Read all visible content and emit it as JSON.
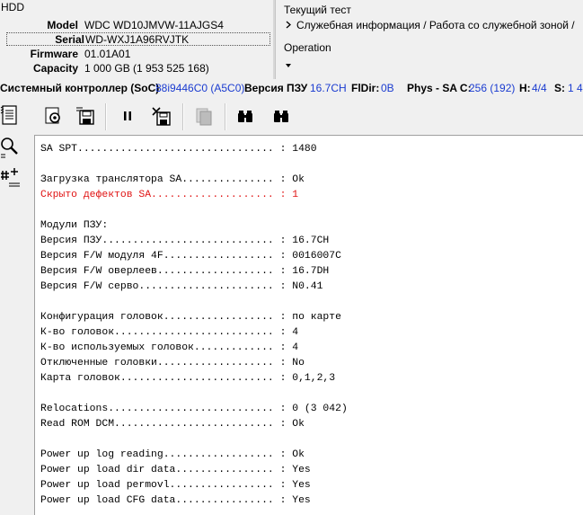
{
  "hdd": {
    "title": "HDD",
    "model_label": "Model",
    "model_value": "WDC WD10JMVW-11AJGS4",
    "serial_label": "Serial",
    "serial_value": "WD-WXJ1A96RVJTK",
    "firmware_label": "Firmware",
    "firmware_value": "01.01A01",
    "capacity_label": "Capacity",
    "capacity_value": "1 000 GB (1 953 525 168)"
  },
  "test": {
    "title": "Текущий тест",
    "current": "Служебная информация / Работа со служебной зоной /",
    "operation_title": "Operation",
    "operation_value": ""
  },
  "status": {
    "soc_label": "Системный контроллер (SoC)",
    "soc_value": "88i9446C0 (A5C0)",
    "rom_label": "Версия ПЗУ",
    "rom_value": "16.7CH",
    "fldir_label": "FlDir:",
    "fldir_value": "0B",
    "physsa_label": "Phys - SA C:",
    "physsa_value": "256 (192)",
    "h_label": "H:",
    "h_value": "4/4",
    "s_label": "S:",
    "s_value": "1 4"
  },
  "icons": {
    "left": [
      "document-list-icon",
      "search-magnifier-icon",
      "grid-plus-icon"
    ],
    "toolbar": [
      "settings-page-icon",
      "save-disk-icon",
      "pause-icon",
      "close-disk-icon",
      "copy-icon",
      "binoculars-icon",
      "binoculars-next-icon"
    ]
  },
  "colors": {
    "accent_blue": "#1a3bd0",
    "warning_red": "#e01515"
  },
  "log_lines": [
    {
      "text": "SA SPT................................ : 1480",
      "color": "normal"
    },
    {
      "text": "",
      "color": "normal"
    },
    {
      "text": "Загрузка транслятора SA............... : Ok",
      "color": "normal"
    },
    {
      "text": "Скрыто дефектов SA.................... : 1",
      "color": "red"
    },
    {
      "text": "",
      "color": "normal"
    },
    {
      "text": "Модули ПЗУ:",
      "color": "normal"
    },
    {
      "text": "Версия ПЗУ............................ : 16.7CH",
      "color": "normal"
    },
    {
      "text": "Версия F/W модуля 4F.................. : 0016007C",
      "color": "normal"
    },
    {
      "text": "Версия F/W оверлеев................... : 16.7DH",
      "color": "normal"
    },
    {
      "text": "Версия F/W серво...................... : N0.41",
      "color": "normal"
    },
    {
      "text": "",
      "color": "normal"
    },
    {
      "text": "Конфигурация головок.................. : по карте",
      "color": "normal"
    },
    {
      "text": "К-во головок.......................... : 4",
      "color": "normal"
    },
    {
      "text": "К-во используемых головок............. : 4",
      "color": "normal"
    },
    {
      "text": "Отключенные головки................... : No",
      "color": "normal"
    },
    {
      "text": "Карта головок......................... : 0,1,2,3",
      "color": "normal"
    },
    {
      "text": "",
      "color": "normal"
    },
    {
      "text": "Relocations........................... : 0 (3 042)",
      "color": "normal"
    },
    {
      "text": "Read ROM DCM.......................... : Ok",
      "color": "normal"
    },
    {
      "text": "",
      "color": "normal"
    },
    {
      "text": "Power up log reading.................. : Ok",
      "color": "normal"
    },
    {
      "text": "Power up load dir data................ : Yes",
      "color": "normal"
    },
    {
      "text": "Power up load permovl................. : Yes",
      "color": "normal"
    },
    {
      "text": "Power up load CFG data................ : Yes",
      "color": "normal"
    }
  ]
}
